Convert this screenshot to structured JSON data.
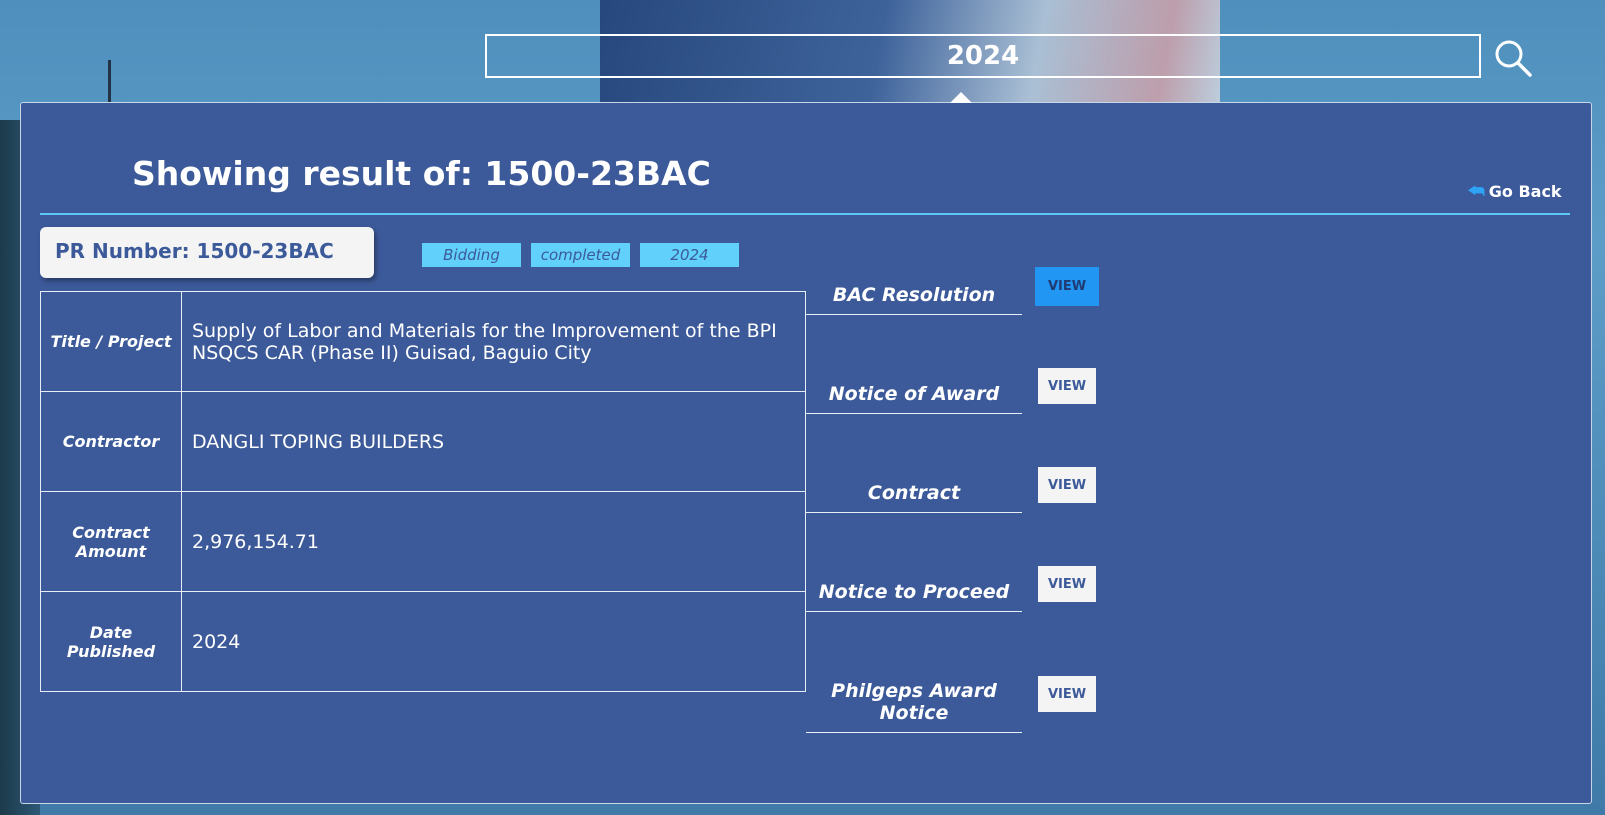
{
  "search": {
    "value": "2024"
  },
  "header": {
    "title": "Showing result of: 1500-23BAC",
    "go_back": "Go Back"
  },
  "pr": {
    "label": "PR Number: 1500-23BAC"
  },
  "tags": [
    "Bidding",
    "completed",
    "2024"
  ],
  "details": [
    {
      "label": "Title / Project",
      "value": "Supply of Labor and Materials for the Improvement of the BPI NSQCS CAR (Phase II) Guisad, Baguio City"
    },
    {
      "label": "Contractor",
      "value": "DANGLI TOPING BUILDERS"
    },
    {
      "label": "Contract Amount",
      "value": "2,976,154.71"
    },
    {
      "label": "Date Published",
      "value": "2024"
    }
  ],
  "documents": [
    {
      "label": "BAC Resolution",
      "button": "VIEW"
    },
    {
      "label": "Notice of Award",
      "button": "VIEW"
    },
    {
      "label": "Contract",
      "button": "VIEW"
    },
    {
      "label": "Notice to Proceed",
      "button": "VIEW"
    },
    {
      "label": "Philgeps Award Notice",
      "button": "VIEW"
    }
  ],
  "colors": {
    "panel": "#3c5a99",
    "accent": "#5ec8f7",
    "tag": "#61d0fb",
    "active_button": "#2196f3"
  },
  "icons": {
    "search": "search-icon",
    "back": "reply-arrow-icon"
  }
}
